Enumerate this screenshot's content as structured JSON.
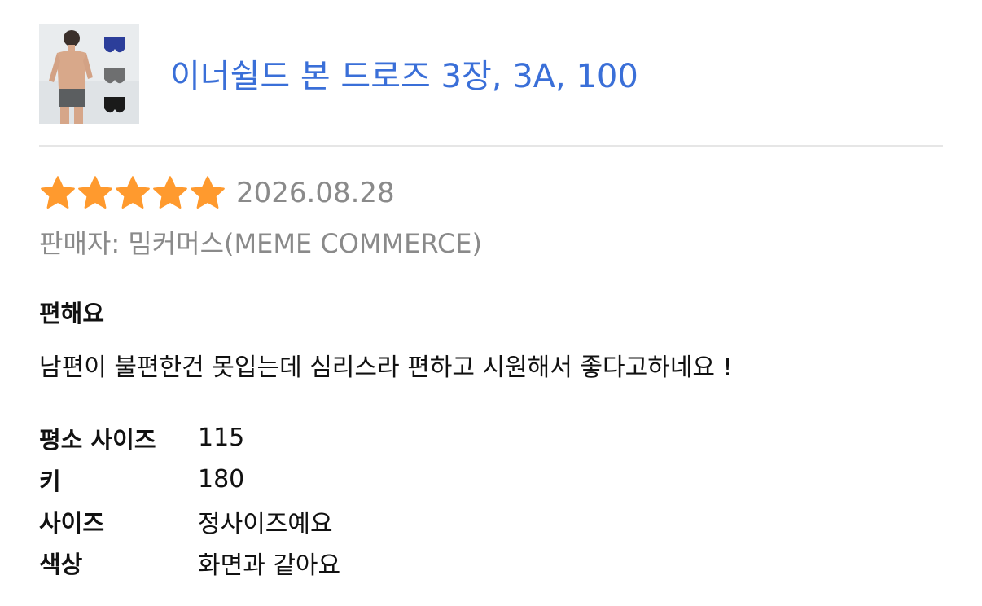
{
  "product": {
    "title": "이너쉴드 본 드로즈 3장, 3A, 100",
    "thumbnail_icon": "product-photo"
  },
  "review": {
    "rating": 5,
    "rating_max": 5,
    "star_color": "#ff9a2e",
    "date": "2026.08.28",
    "seller": "판매자: 밈커머스(MEME COMMERCE)",
    "headline": "편해요",
    "body": "남편이 불편한건 못입는데 심리스라 편하고 시원해서 좋다고하네요 !",
    "attributes": [
      {
        "key": "평소 사이즈",
        "value": "115"
      },
      {
        "key": "키",
        "value": "180"
      },
      {
        "key": "사이즈",
        "value": "정사이즈예요"
      },
      {
        "key": "색상",
        "value": "화면과 같아요"
      }
    ]
  },
  "colors": {
    "title_link": "#3a6fd8",
    "muted_text": "#8a8a8a",
    "divider": "#e6e6e6"
  }
}
